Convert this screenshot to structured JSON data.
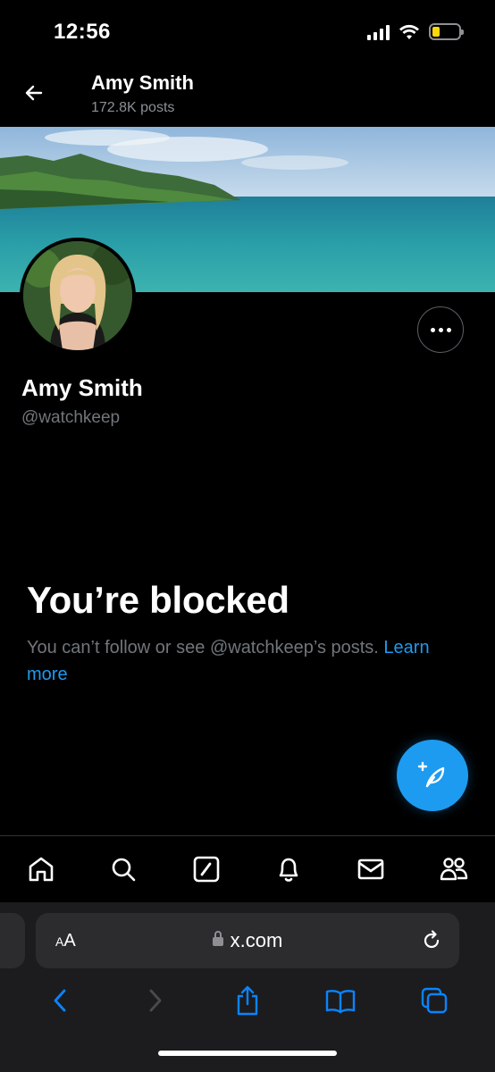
{
  "status_bar": {
    "time": "12:56",
    "battery_level": 0.3,
    "battery_color": "#ffd60a"
  },
  "header": {
    "title": "Amy Smith",
    "subtitle": "172.8K posts",
    "back_icon": "arrow-left-icon"
  },
  "profile": {
    "name": "Amy Smith",
    "handle": "@watchkeep",
    "more_icon": "more-horizontal-icon"
  },
  "blocked": {
    "title": "You’re blocked",
    "message": "You can’t follow or see @watchkeep’s posts. ",
    "link": "Learn more"
  },
  "fab": {
    "icon": "compose-post-icon",
    "color": "#1d9bf0"
  },
  "bottom_nav": [
    {
      "name": "home",
      "icon": "home-icon"
    },
    {
      "name": "search",
      "icon": "search-icon"
    },
    {
      "name": "grok",
      "icon": "grok-icon"
    },
    {
      "name": "notifications",
      "icon": "bell-icon"
    },
    {
      "name": "messages",
      "icon": "mail-icon"
    },
    {
      "name": "communities",
      "icon": "people-icon"
    }
  ],
  "browser": {
    "aa_label_small": "A",
    "aa_label_large": "A",
    "url": "x.com",
    "accent": "#0a84ff",
    "toolbar": [
      "back-icon",
      "forward-icon",
      "share-icon",
      "bookmarks-icon",
      "tabs-icon"
    ]
  }
}
